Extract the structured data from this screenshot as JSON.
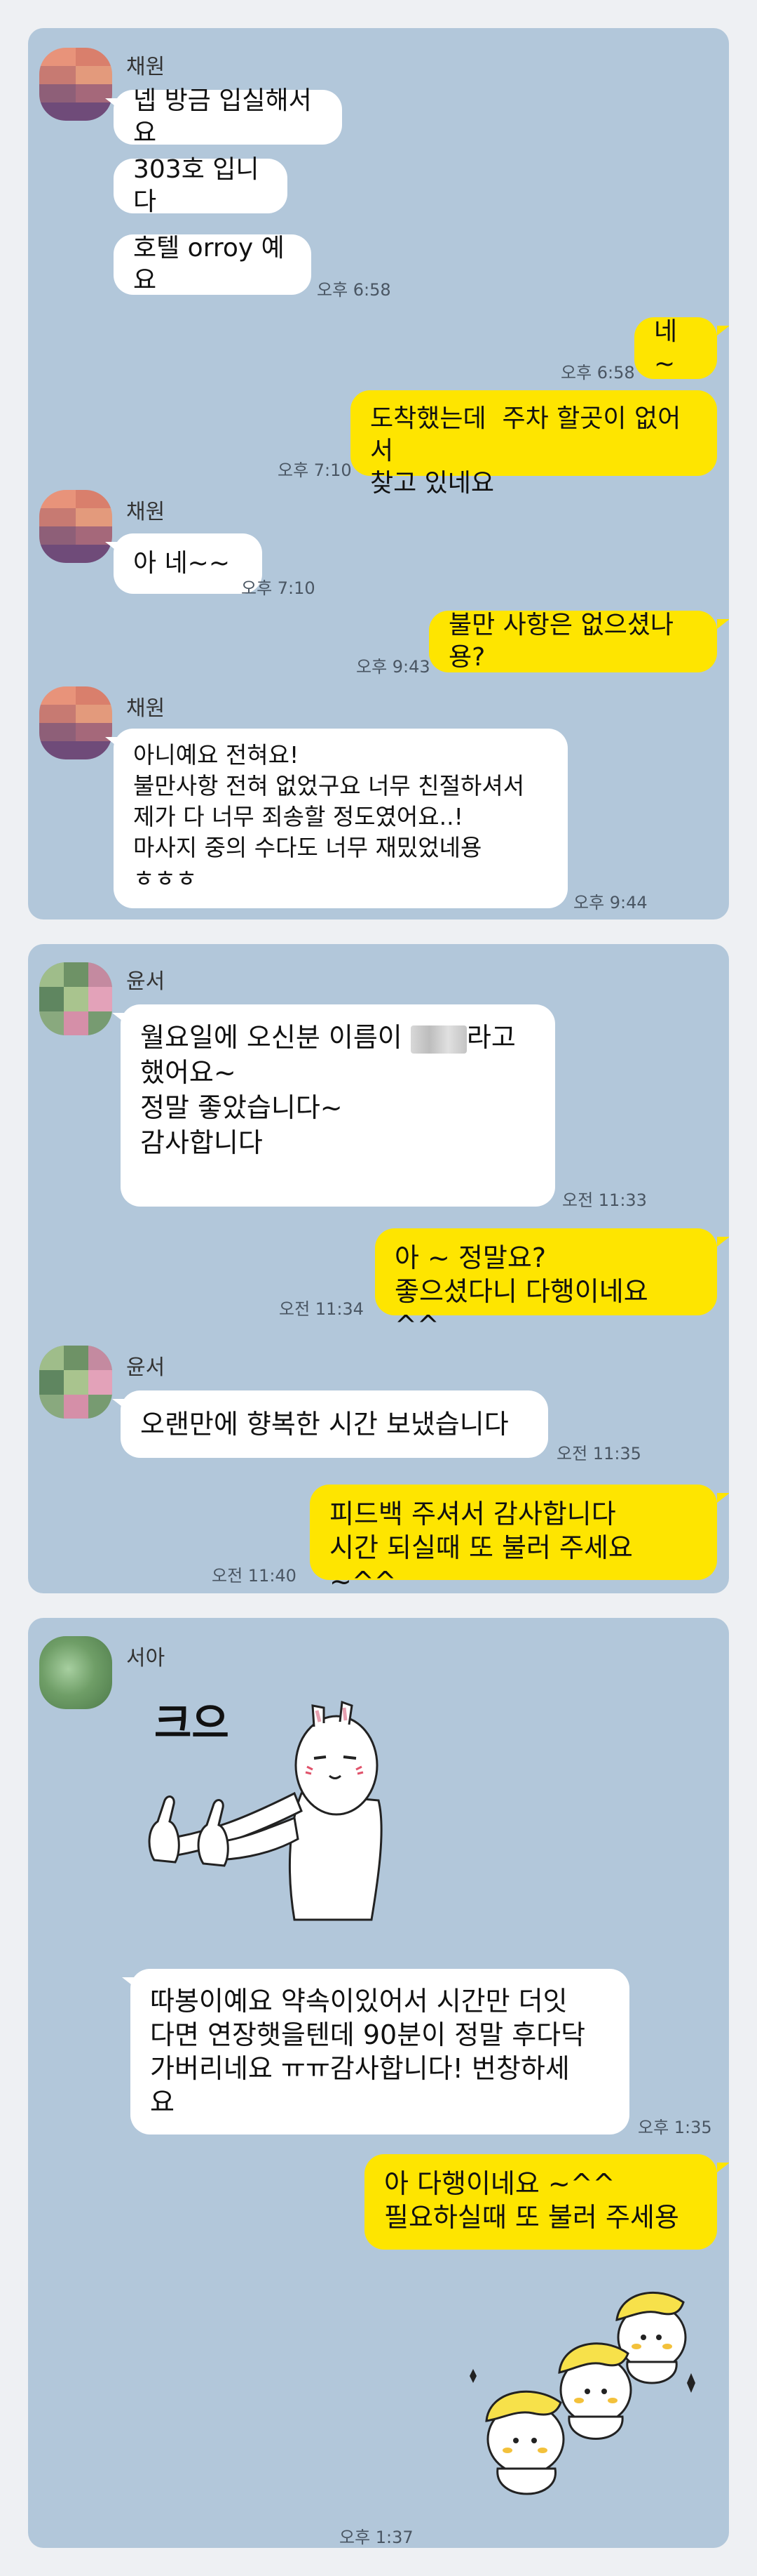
{
  "panel1": {
    "sender": "채원",
    "msgs": [
      "넵 방금 입실해서요",
      "303호 입니다",
      "호텔 orroy 예요"
    ],
    "time1": "오후 6:58",
    "me1": "네 ~",
    "me1_time": "오후 6:58",
    "me2": "도착했는데  주차 할곳이 없어서\n찾고 있네요",
    "me2_time": "오후 7:10",
    "sender2": "채원",
    "msg4": "아 네~~",
    "time4": "오후 7:10",
    "me3": "불만 사항은 없으셨나용?",
    "me3_time": "오후 9:43",
    "sender3": "채원",
    "msg5": "아니예요 전혀요!\n불만사항 전혀 없었구요 너무 친절하셔서\n제가 다 너무 죄송할 정도였어요..!\n마사지 중의 수다도 너무 재밌었네용\nㅎㅎㅎ",
    "time5": "오후 9:44"
  },
  "panel2": {
    "sender": "윤서",
    "msg1_a": "월요일에 오신분 이름이",
    "msg1_b": "라고\n했어요~\n정말 좋았습니다~\n감사합니다",
    "time1": "오전 11:33",
    "me1": "아 ~ 정말요?\n좋으셨다니 다행이네요 ^^",
    "me1_time": "오전 11:34",
    "sender2": "윤서",
    "msg2": "오랜만에 향복한 시간 보냈습니다",
    "time2": "오전 11:35",
    "me2": "피드백 주셔서 감사합니다\n시간 되실때 또 불러 주세요 ~^^",
    "me2_time": "오전 11:40"
  },
  "panel3": {
    "sender": "서아",
    "sticker_text": "크으",
    "msg1": "따봉이예요 약속이있어서 시간만 더잇\n다면 연장햇을텐데 90분이 정말 후다닥\n가버리네요 ㅠㅠ감사합니다! 번창하세\n요",
    "time1": "오후 1:35",
    "me1": "아 다행이네요 ~^^\n필요하실때 또 불러 주세용",
    "me1_time": "오후 1:37"
  },
  "colors": {
    "chat_bg": "#b2c7da",
    "my_bubble": "#fee500",
    "their_bubble": "#ffffff",
    "page_bg": "#eef0f3"
  }
}
